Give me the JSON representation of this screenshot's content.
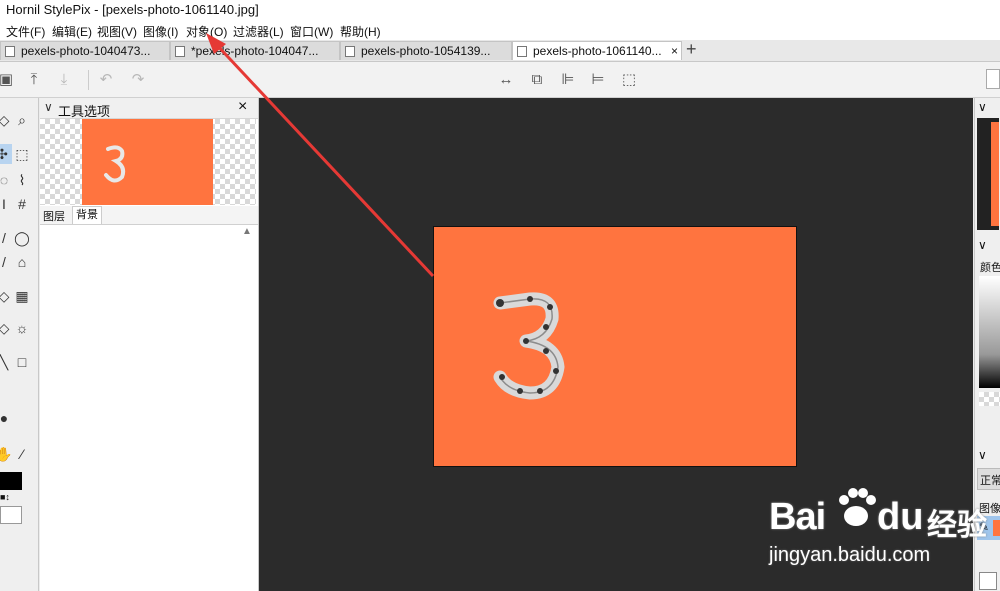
{
  "window": {
    "title": "Hornil StylePix - [pexels-photo-1061140.jpg]"
  },
  "menu": [
    {
      "label": "文件(F)"
    },
    {
      "label": "编辑(E)"
    },
    {
      "label": "视图(V)"
    },
    {
      "label": "图像(I)"
    },
    {
      "label": "对象(O)"
    },
    {
      "label": "过滤器(L)"
    },
    {
      "label": "窗口(W)"
    },
    {
      "label": "帮助(H)"
    }
  ],
  "tabs": [
    {
      "label": "pexels-photo-1040473..."
    },
    {
      "label": "*pexels-photo-104047..."
    },
    {
      "label": "pexels-photo-1054139..."
    },
    {
      "label": "pexels-photo-1061140...",
      "active": true,
      "close": "×"
    }
  ],
  "tab_add": "+",
  "tool_options": {
    "title": "工具选项",
    "close": "×",
    "layers_tabs": [
      {
        "label": "图层"
      },
      {
        "label": "背景"
      }
    ],
    "collapse": "▽"
  },
  "right_panel": {
    "labels": [
      "颜色",
      "正常",
      "图像"
    ]
  },
  "watermark": {
    "brand": "Bai",
    "brand2": "du",
    "cn": "经验",
    "url": "jingyan.baidu.com"
  },
  "colors": {
    "accent_orange": "#ff743f",
    "canvas_bg": "#2b2b2b",
    "annotation_arrow": "#e53935",
    "selected_tab": "#ffffff",
    "watermark_blue": "#2b5fc4"
  }
}
